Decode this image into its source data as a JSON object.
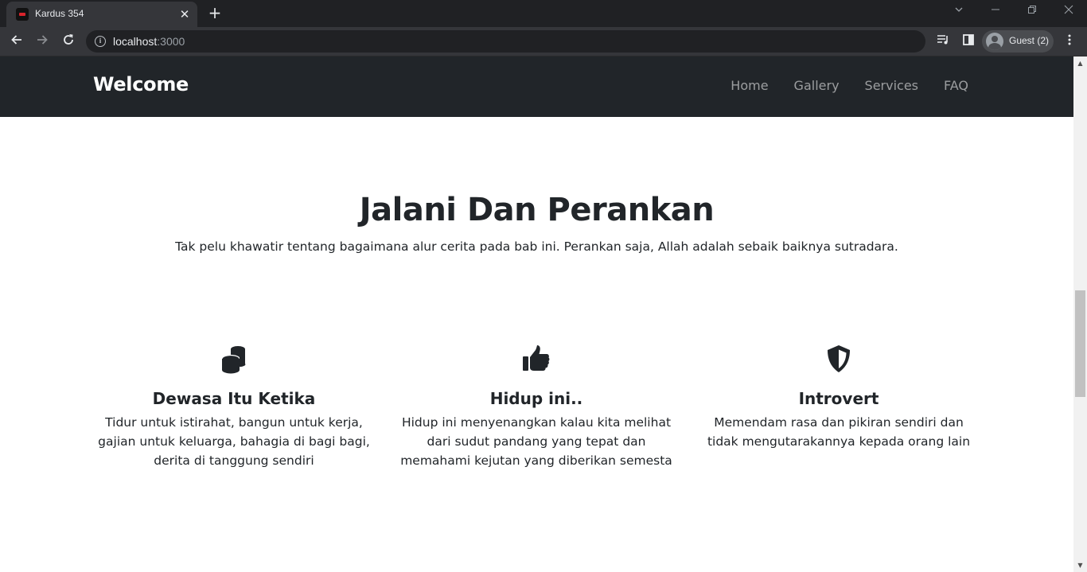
{
  "browser": {
    "tab_title": "Kardus 354",
    "tab_close": "✕",
    "new_tab": "+",
    "url_host": "localhost",
    "url_port": ":3000",
    "profile_label": "Guest (2)"
  },
  "page": {
    "brand": "Welcome",
    "nav": [
      "Home",
      "Gallery",
      "Services",
      "FAQ"
    ],
    "hero": {
      "title": "Jalani Dan Perankan",
      "subtitle": "Tak pelu khawatir tentang bagaimana alur cerita pada bab ini. Perankan saja, Allah adalah sebaik baiknya sutradara."
    },
    "features": [
      {
        "icon": "coins-icon",
        "title": "Dewasa Itu Ketika",
        "text": "Tidur untuk istirahat, bangun untuk kerja, gajian untuk keluarga, bahagia di bagi bagi, derita di tanggung sendiri"
      },
      {
        "icon": "thumbs-up-icon",
        "title": "Hidup ini..",
        "text": "Hidup ini menyenangkan kalau kita melihat dari sudut pandang yang tepat dan memahami kejutan yang diberikan semesta"
      },
      {
        "icon": "shield-icon",
        "title": "Introvert",
        "text": "Memendam rasa dan pikiran sendiri dan tidak mengutarakannya kepada orang lain"
      }
    ]
  },
  "colors": {
    "navbar_bg": "#212529",
    "text_dark": "#212529",
    "chrome_dark": "#202124",
    "chrome_toolbar": "#35363a"
  }
}
